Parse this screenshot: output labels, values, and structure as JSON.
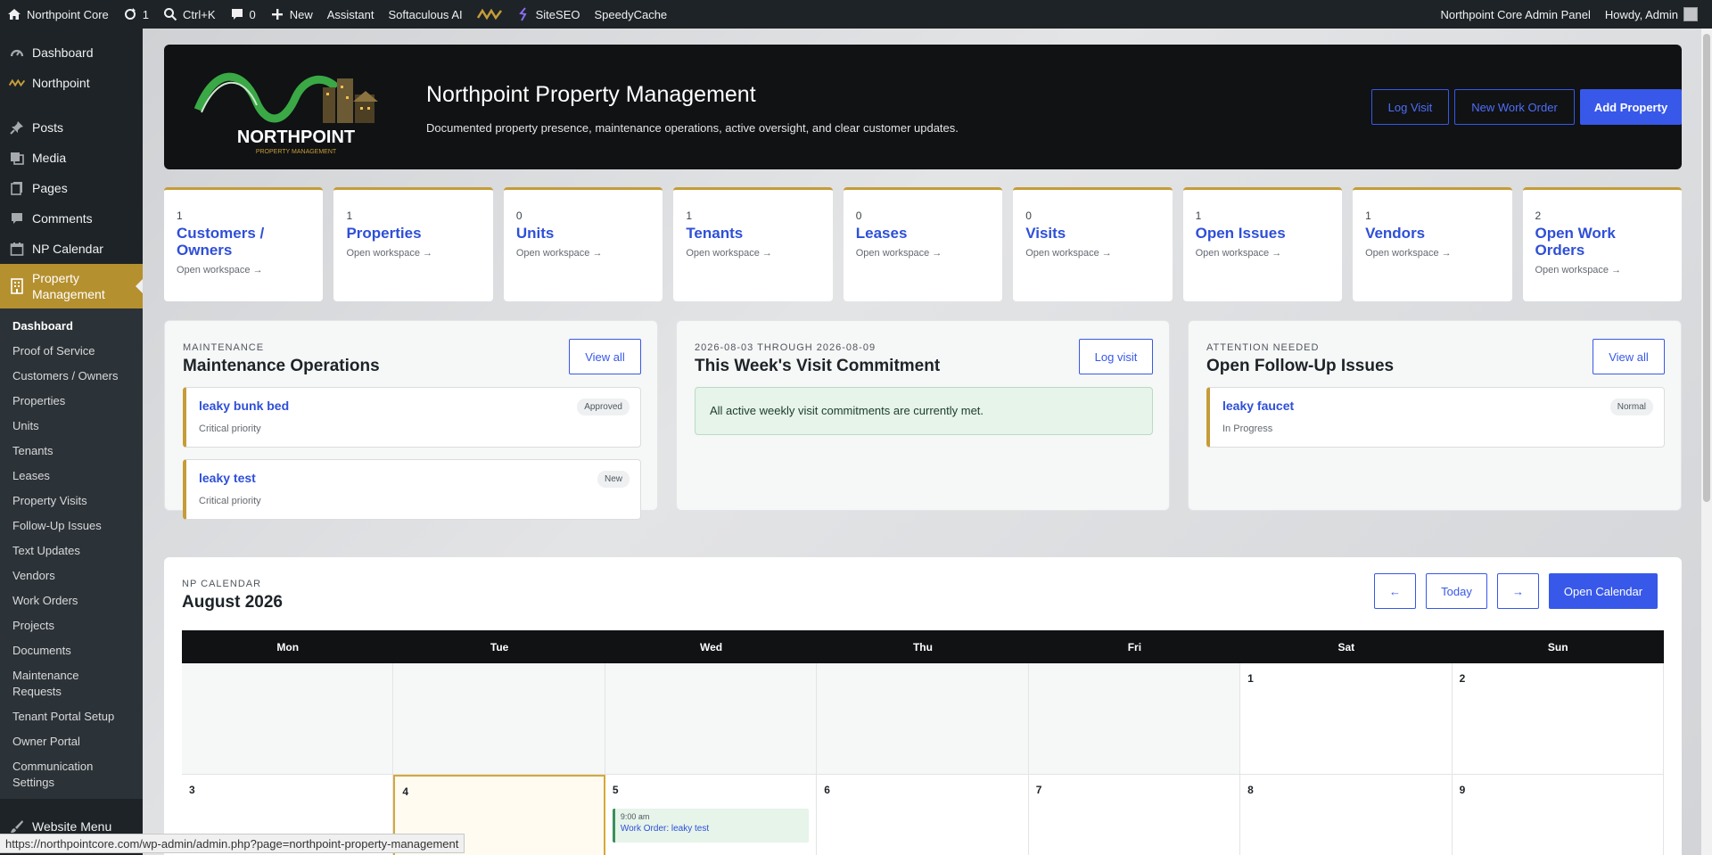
{
  "adminbar": {
    "site_name": "Northpoint Core",
    "updates_count": "1",
    "search_shortcut": "Ctrl+K",
    "comments_count": "0",
    "new_label": "New",
    "assistant_label": "Assistant",
    "softaculous_label": "Softaculous AI",
    "siteseo_label": "SiteSEO",
    "speedycache_label": "SpeedyCache",
    "panel_label": "Northpoint Core Admin Panel",
    "howdy_label": "Howdy, Admin"
  },
  "sidebar": {
    "top_items": [
      {
        "label": "Dashboard",
        "icon": "dashboard-icon"
      },
      {
        "label": "Northpoint",
        "icon": "northpoint-logo-icon"
      }
    ],
    "main_items": [
      {
        "label": "Posts",
        "icon": "pin-icon"
      },
      {
        "label": "Media",
        "icon": "media-icon"
      },
      {
        "label": "Pages",
        "icon": "pages-icon"
      },
      {
        "label": "Comments",
        "icon": "comment-icon"
      },
      {
        "label": "NP Calendar",
        "icon": "calendar-icon"
      }
    ],
    "current": {
      "label": "Property Management",
      "icon": "building-icon"
    },
    "sub_items": [
      "Dashboard",
      "Proof of Service",
      "Customers / Owners",
      "Properties",
      "Units",
      "Tenants",
      "Leases",
      "Property Visits",
      "Follow-Up Issues",
      "Text Updates",
      "Vendors",
      "Work Orders",
      "Projects",
      "Documents",
      "Maintenance Requests",
      "Tenant Portal Setup",
      "Owner Portal",
      "Communication Settings"
    ],
    "after_items": [
      {
        "label": "Website Menu",
        "icon": "brush-icon"
      }
    ]
  },
  "hero": {
    "logo_text": "NORTHPOINT",
    "logo_tagline": "PROPERTY MANAGEMENT",
    "title": "Northpoint Property Management",
    "subtitle": "Documented property presence, maintenance operations, active oversight, and clear customer updates.",
    "log_visit": "Log Visit",
    "new_work_order": "New Work Order",
    "add_property": "Add Property"
  },
  "stats": [
    {
      "num": "1",
      "label": "Customers / Owners",
      "link": "Open workspace →"
    },
    {
      "num": "1",
      "label": "Properties",
      "link": "Open workspace →"
    },
    {
      "num": "0",
      "label": "Units",
      "link": "Open workspace →"
    },
    {
      "num": "1",
      "label": "Tenants",
      "link": "Open workspace →"
    },
    {
      "num": "0",
      "label": "Leases",
      "link": "Open workspace →"
    },
    {
      "num": "0",
      "label": "Visits",
      "link": "Open workspace →"
    },
    {
      "num": "1",
      "label": "Open Issues",
      "link": "Open workspace →"
    },
    {
      "num": "1",
      "label": "Vendors",
      "link": "Open workspace →"
    },
    {
      "num": "2",
      "label": "Open Work Orders",
      "link": "Open workspace →"
    }
  ],
  "maintenance": {
    "kicker": "Maintenance",
    "title": "Maintenance Operations",
    "button": "View all",
    "items": [
      {
        "title": "leaky bunk bed",
        "sub": "Critical priority",
        "badge": "Approved"
      },
      {
        "title": "leaky test",
        "sub": "Critical priority",
        "badge": "New"
      }
    ]
  },
  "visits": {
    "kicker": "2026-08-03 through 2026-08-09",
    "title": "This Week's Visit Commitment",
    "button": "Log visit",
    "notice": "All active weekly visit commitments are currently met."
  },
  "issues": {
    "kicker": "Attention needed",
    "title": "Open Follow-Up Issues",
    "button": "View all",
    "items": [
      {
        "title": "leaky faucet",
        "sub": "In Progress",
        "badge": "Normal"
      }
    ]
  },
  "calendar": {
    "kicker": "NP Calendar",
    "title": "August 2026",
    "prev": "←",
    "today": "Today",
    "next": "→",
    "open": "Open Calendar",
    "weekdays": [
      "Mon",
      "Tue",
      "Wed",
      "Thu",
      "Fri",
      "Sat",
      "Sun"
    ],
    "days": [
      "",
      "",
      "",
      "",
      "",
      "1",
      "2",
      "3",
      "4",
      "5",
      "6",
      "7",
      "8",
      "9"
    ],
    "event": {
      "time": "9:00 am",
      "name": "Work Order: leaky test"
    }
  },
  "statusbar": {
    "url": "https://northpointcore.com/wp-admin/admin.php?page=northpoint-property-management"
  },
  "colors": {
    "accent": "#3858e9",
    "gold": "#c59c38",
    "adminbar": "#1d2327"
  }
}
